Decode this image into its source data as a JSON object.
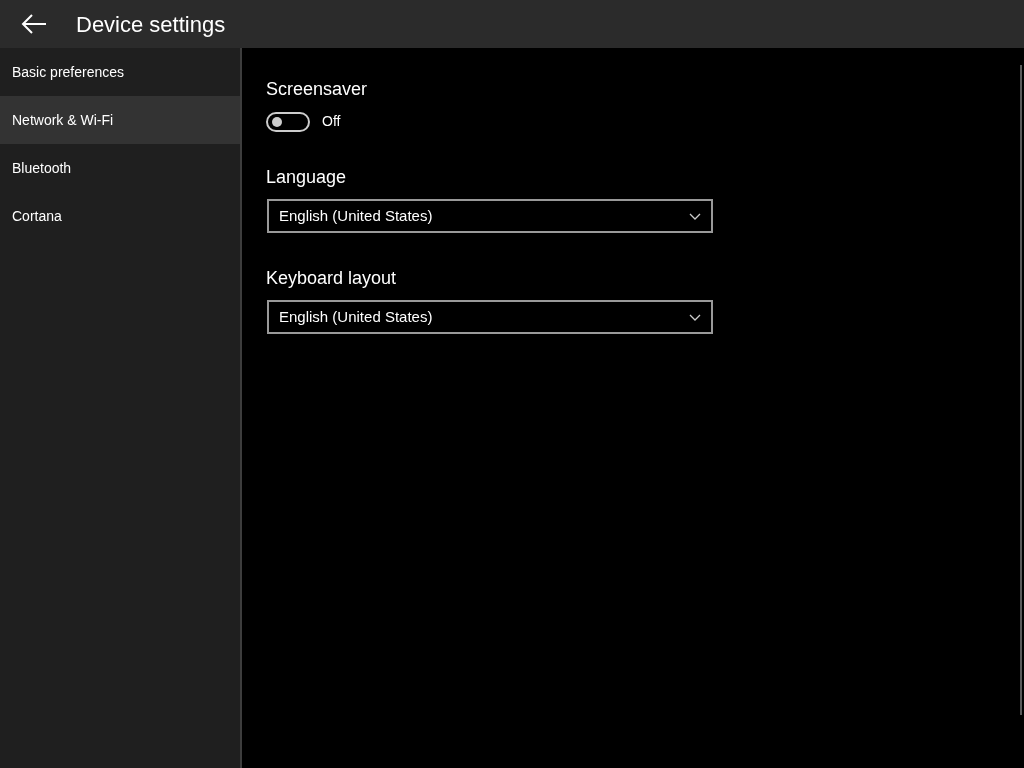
{
  "header": {
    "title": "Device settings"
  },
  "sidebar": {
    "items": [
      {
        "label": "Basic preferences",
        "selected": false
      },
      {
        "label": "Network & Wi-Fi",
        "selected": true
      },
      {
        "label": "Bluetooth",
        "selected": false
      },
      {
        "label": "Cortana",
        "selected": false
      }
    ]
  },
  "settings": [
    {
      "kind": "toggle",
      "label": "Screensaver",
      "on": false,
      "state_text": "Off"
    },
    {
      "kind": "dropdown",
      "label": "Language",
      "value": "English (United States)"
    },
    {
      "kind": "dropdown",
      "label": "Keyboard layout",
      "value": "English (United States)"
    }
  ]
}
